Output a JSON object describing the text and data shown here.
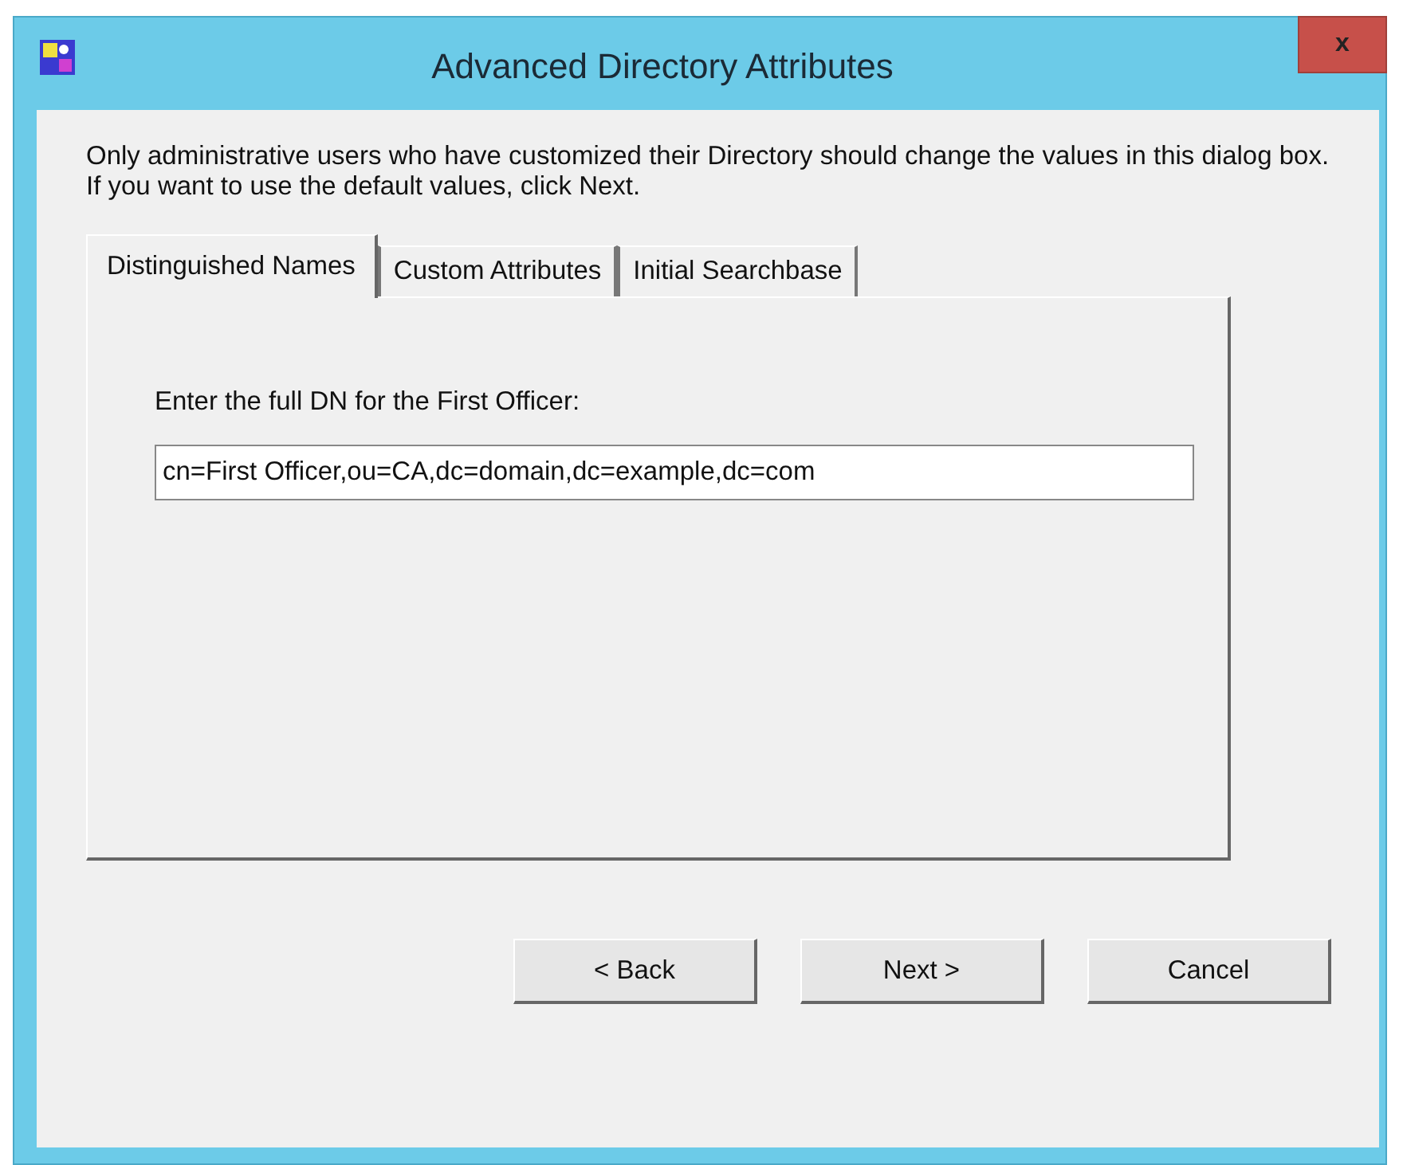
{
  "window": {
    "title": "Advanced Directory Attributes",
    "close_button": "x"
  },
  "intro": [
    "Only administrative users who have customized their Directory should change the values in this dialog box.",
    "If you want to use the default values, click Next."
  ],
  "tabs": [
    {
      "label": "Distinguished Names",
      "selected": true
    },
    {
      "label": "Custom Attributes",
      "selected": false
    },
    {
      "label": "Initial Searchbase",
      "selected": false
    }
  ],
  "panel": {
    "label": "Enter the full DN for the First Officer:",
    "value": "cn=First Officer,ou=CA,dc=domain,dc=example,dc=com"
  },
  "buttons": [
    "< Back",
    "Next >",
    "Cancel"
  ]
}
